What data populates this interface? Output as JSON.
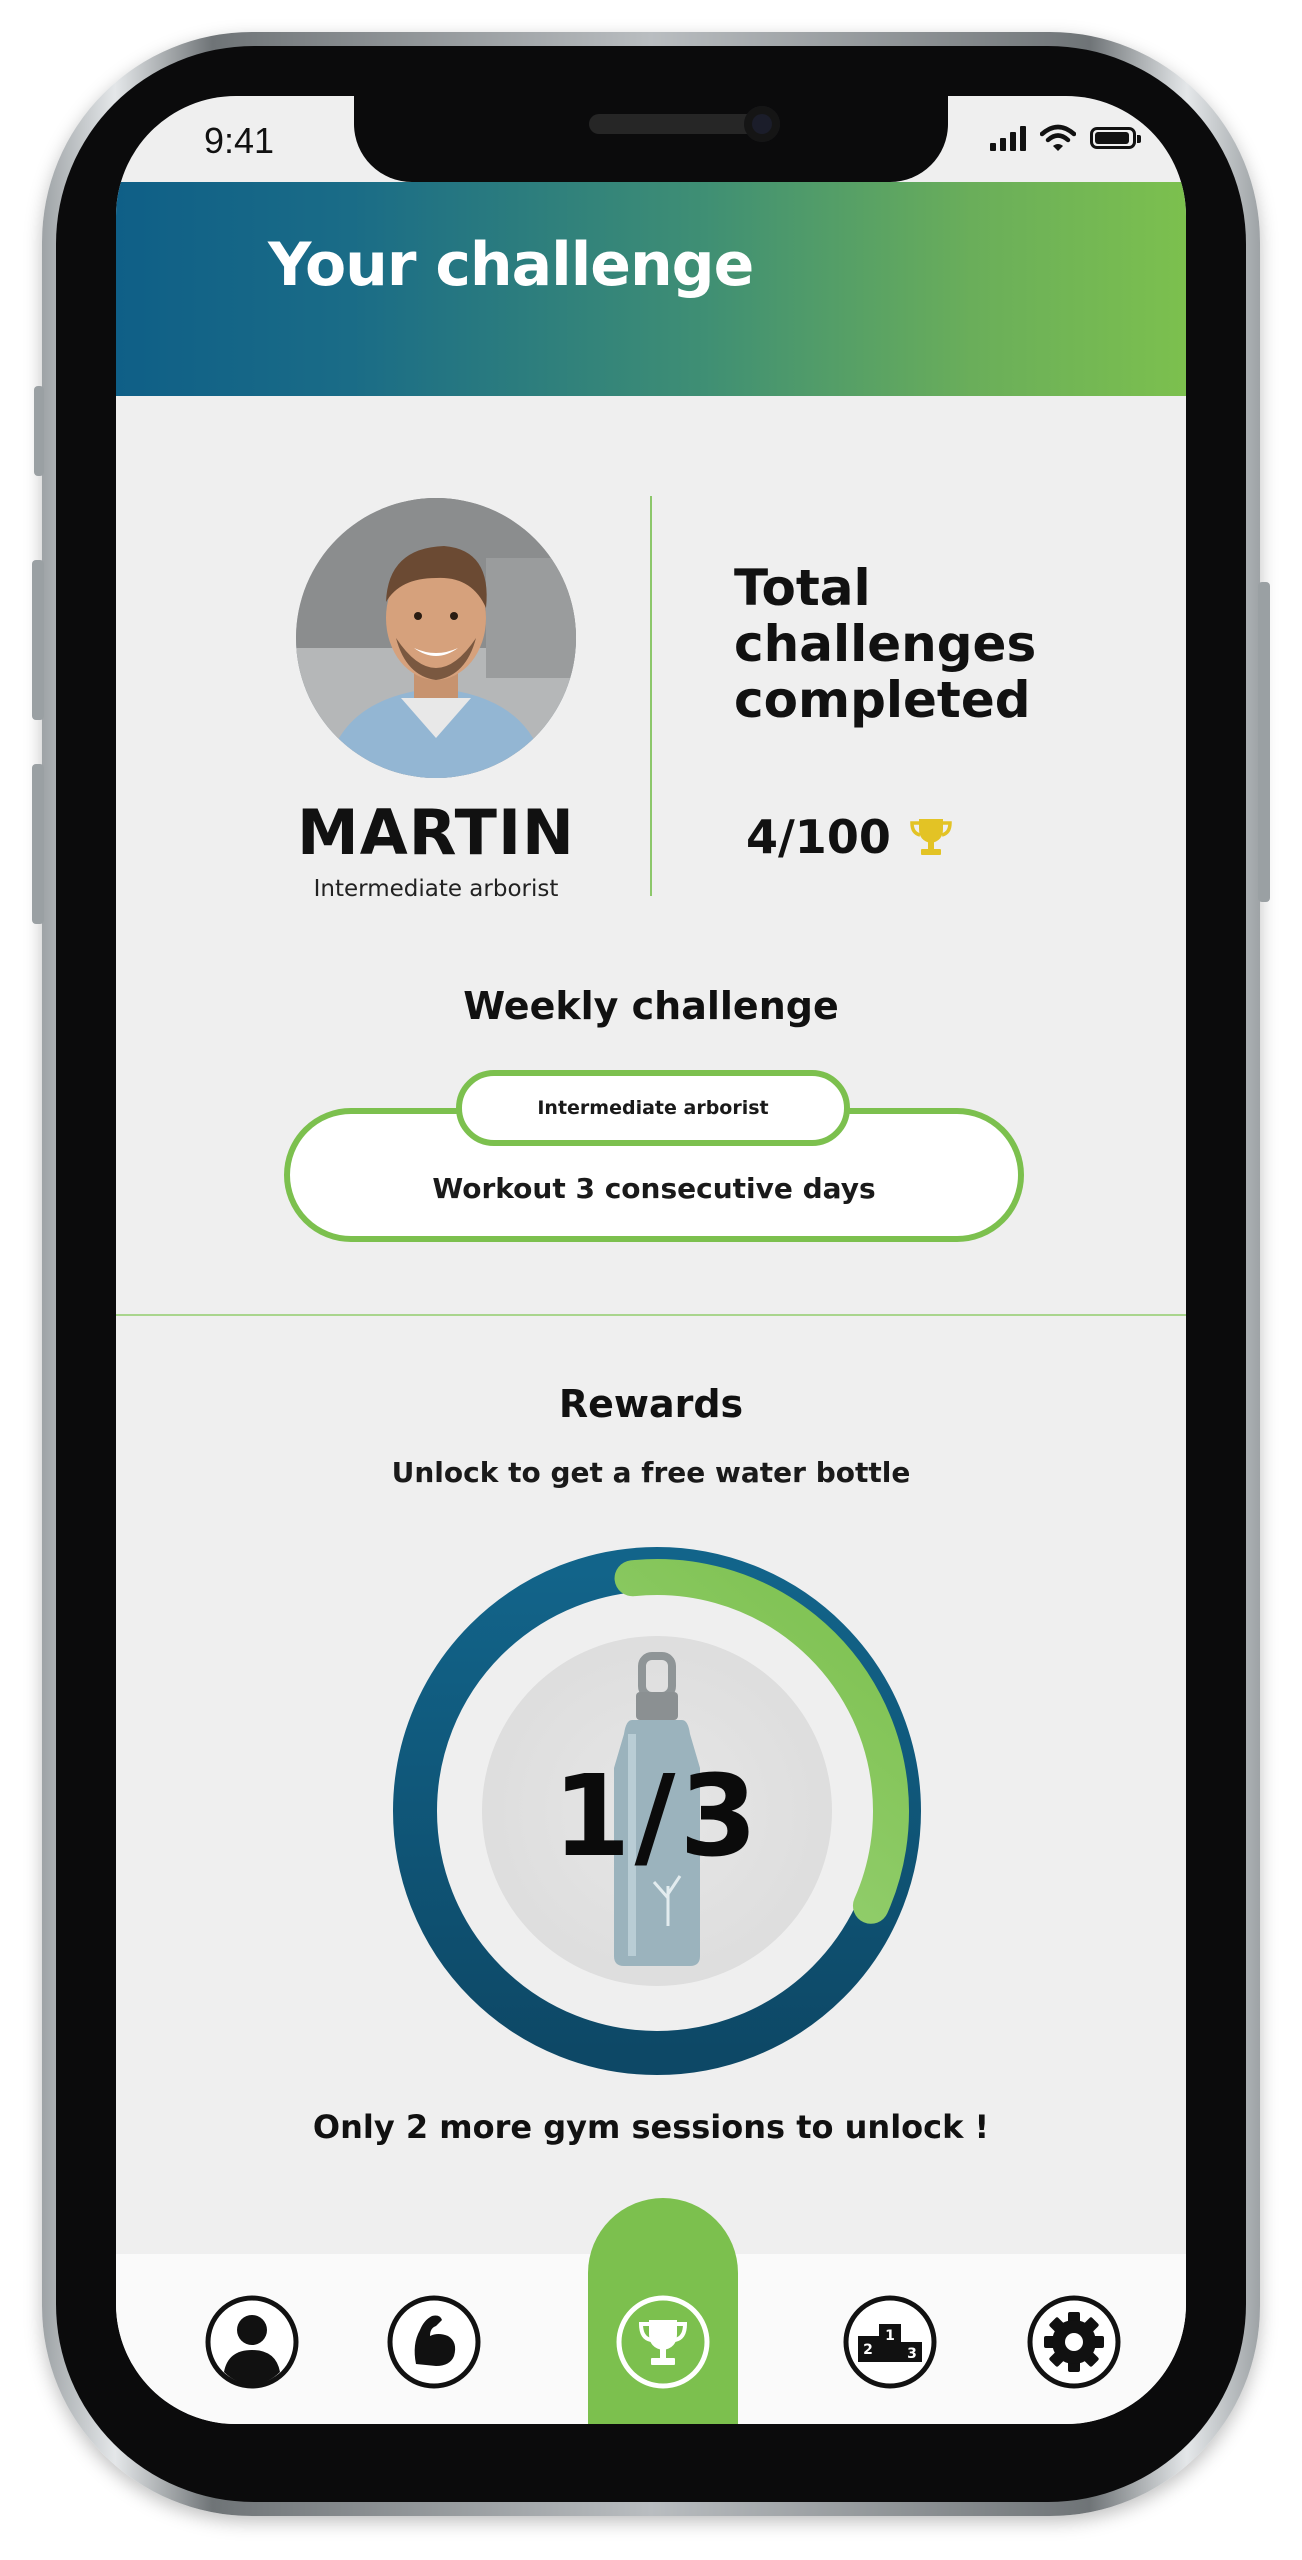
{
  "status_bar": {
    "time": "9:41"
  },
  "header": {
    "title": "Your challenge"
  },
  "profile": {
    "name": "MARTIN",
    "role": "Intermediate arborist"
  },
  "stats": {
    "title_lines": [
      "Total",
      "challenges",
      "completed"
    ],
    "count": "4/100"
  },
  "weekly": {
    "title": "Weekly challenge",
    "level": "Intermediate arborist",
    "task": "Workout 3 consecutive days"
  },
  "rewards": {
    "title": "Rewards",
    "subtitle": "Unlock to get a free water bottle",
    "progress_label": "1/3",
    "progress_fraction": 0.333,
    "message": "Only 2 more gym sessions to unlock !"
  },
  "nav": {
    "items": [
      {
        "icon": "profile-icon",
        "active": false
      },
      {
        "icon": "muscle-icon",
        "active": false
      },
      {
        "icon": "trophy-icon",
        "active": true
      },
      {
        "icon": "leaderboard-icon",
        "active": false
      },
      {
        "icon": "gear-icon",
        "active": false
      }
    ]
  },
  "colors": {
    "accent_green": "#7cc04e",
    "accent_blue": "#0f5f87",
    "trophy_gold": "#e3c325"
  }
}
